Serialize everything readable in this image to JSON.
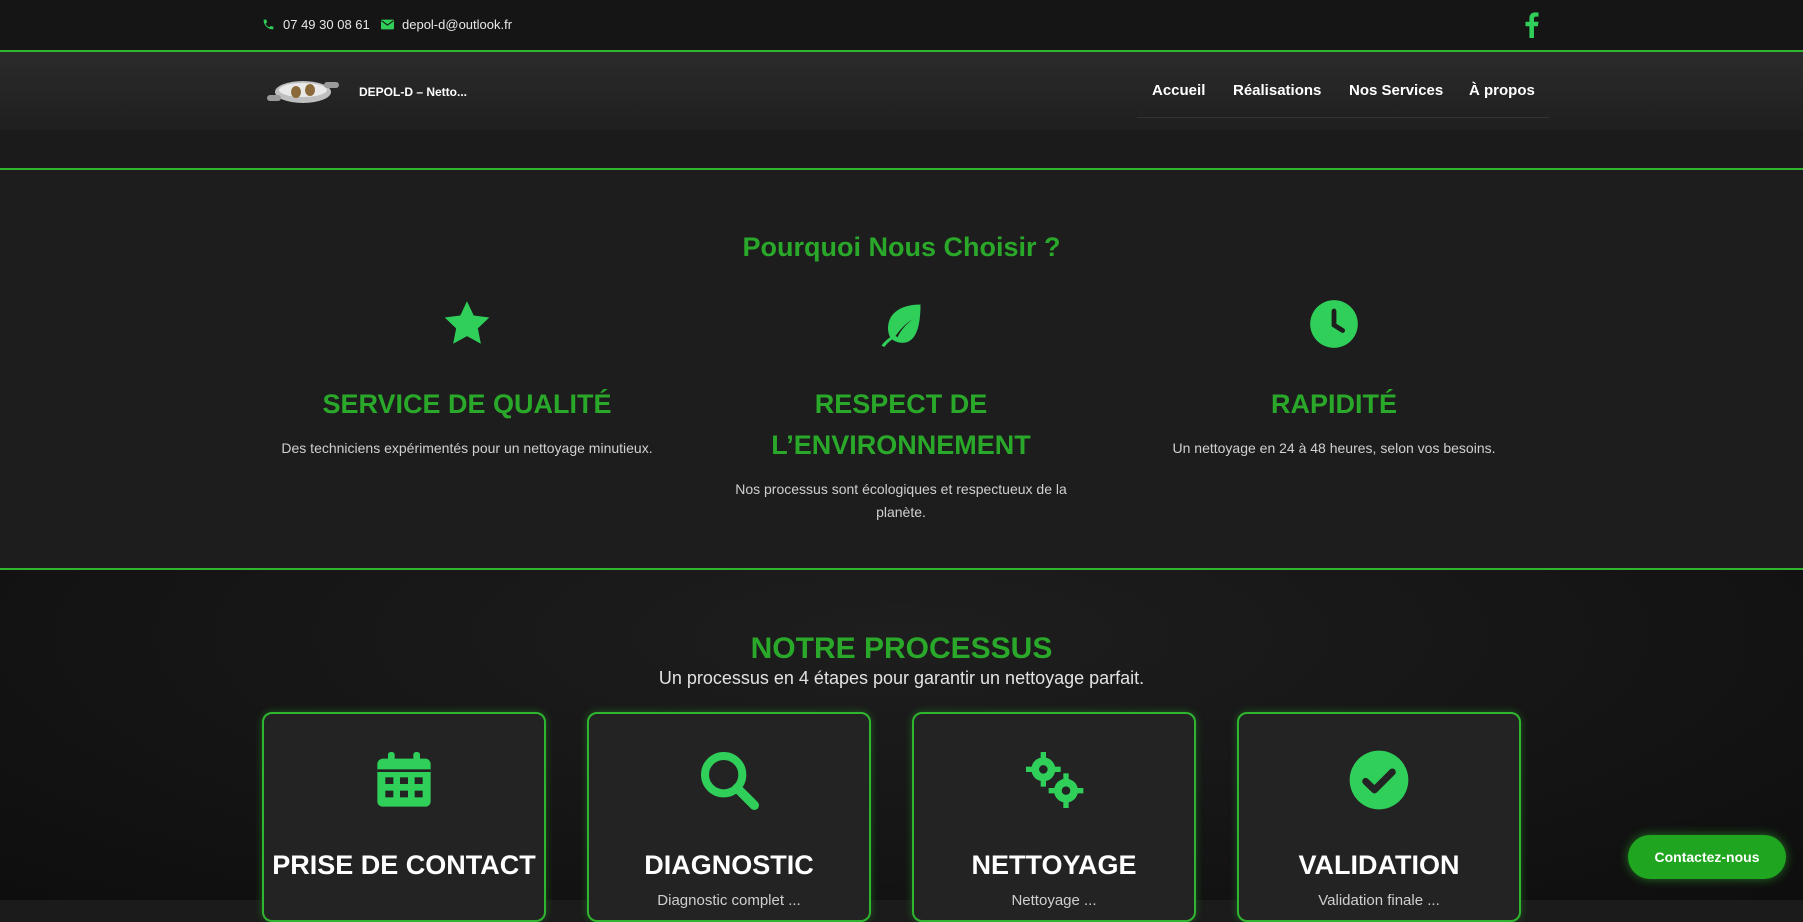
{
  "topbar": {
    "phone": "07 49 30 08 61",
    "email": "depol-d@outlook.fr"
  },
  "header": {
    "brand": "DEPOL-D – Netto...",
    "nav": [
      "Accueil",
      "Réalisations",
      "Nos Services",
      "À propos"
    ]
  },
  "why": {
    "title": "Pourquoi Nous Choisir ?",
    "features": [
      {
        "icon": "star-icon",
        "title": "SERVICE DE QUALITÉ",
        "text": "Des techniciens expérimentés pour un nettoyage minutieux."
      },
      {
        "icon": "leaf-icon",
        "title": "RESPECT DE L’ENVIRONNEMENT",
        "text": "Nos processus sont écologiques et respectueux de la planète."
      },
      {
        "icon": "clock-icon",
        "title": "RAPIDITÉ",
        "text": "Un nettoyage en 24 à 48 heures, selon vos besoins."
      }
    ]
  },
  "process": {
    "title": "NOTRE PROCESSUS",
    "subtitle": "Un processus en 4 étapes pour garantir un nettoyage parfait.",
    "steps": [
      {
        "icon": "calendar-icon",
        "title": "PRISE DE CONTACT",
        "text": ""
      },
      {
        "icon": "search-icon",
        "title": "DIAGNOSTIC",
        "text": "Diagnostic complet ..."
      },
      {
        "icon": "cogs-icon",
        "title": "NETTOYAGE",
        "text": "Nettoyage ..."
      },
      {
        "icon": "check-circle-icon",
        "title": "VALIDATION",
        "text": "Validation finale ..."
      }
    ]
  },
  "cta": {
    "label": "Contactez-nous"
  },
  "colors": {
    "accent": "#2fb52f",
    "heading_green": "#2aa82a",
    "background": "#1b1b1b"
  }
}
